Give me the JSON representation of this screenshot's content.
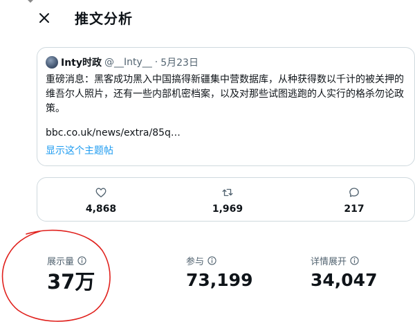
{
  "header": {
    "title": "推文分析"
  },
  "tweet": {
    "author_name": "Inty时政",
    "author_handle": "@__Inty__",
    "separator": "·",
    "date": "5月23日",
    "body": "重磅消息：黑客成功黑入中国搞得新疆集中营数据库，从种获得数以千计的被关押的维吾尔人照片，还有一些内部机密档案，以及对那些试图逃跑的人实行的格杀勿论政策。",
    "link": "bbc.co.uk/news/extra/85q…",
    "show_thread": "显示这个主题帖"
  },
  "metrics": {
    "likes": "4,868",
    "retweets": "1,969",
    "replies": "217"
  },
  "stats": {
    "impressions_label": "展示量",
    "impressions_value": "37万",
    "engagements_label": "参与",
    "engagements_value": "73,199",
    "details_label": "详情展开",
    "details_value": "34,047"
  },
  "colors": {
    "text": "#0f1419",
    "secondary": "#536471",
    "link": "#1d9bf0",
    "border": "#cfd9de",
    "annotation": "#e0201c"
  },
  "icons": [
    "close-icon",
    "avatar",
    "heart-icon",
    "retweet-icon",
    "reply-icon",
    "info-icon"
  ]
}
